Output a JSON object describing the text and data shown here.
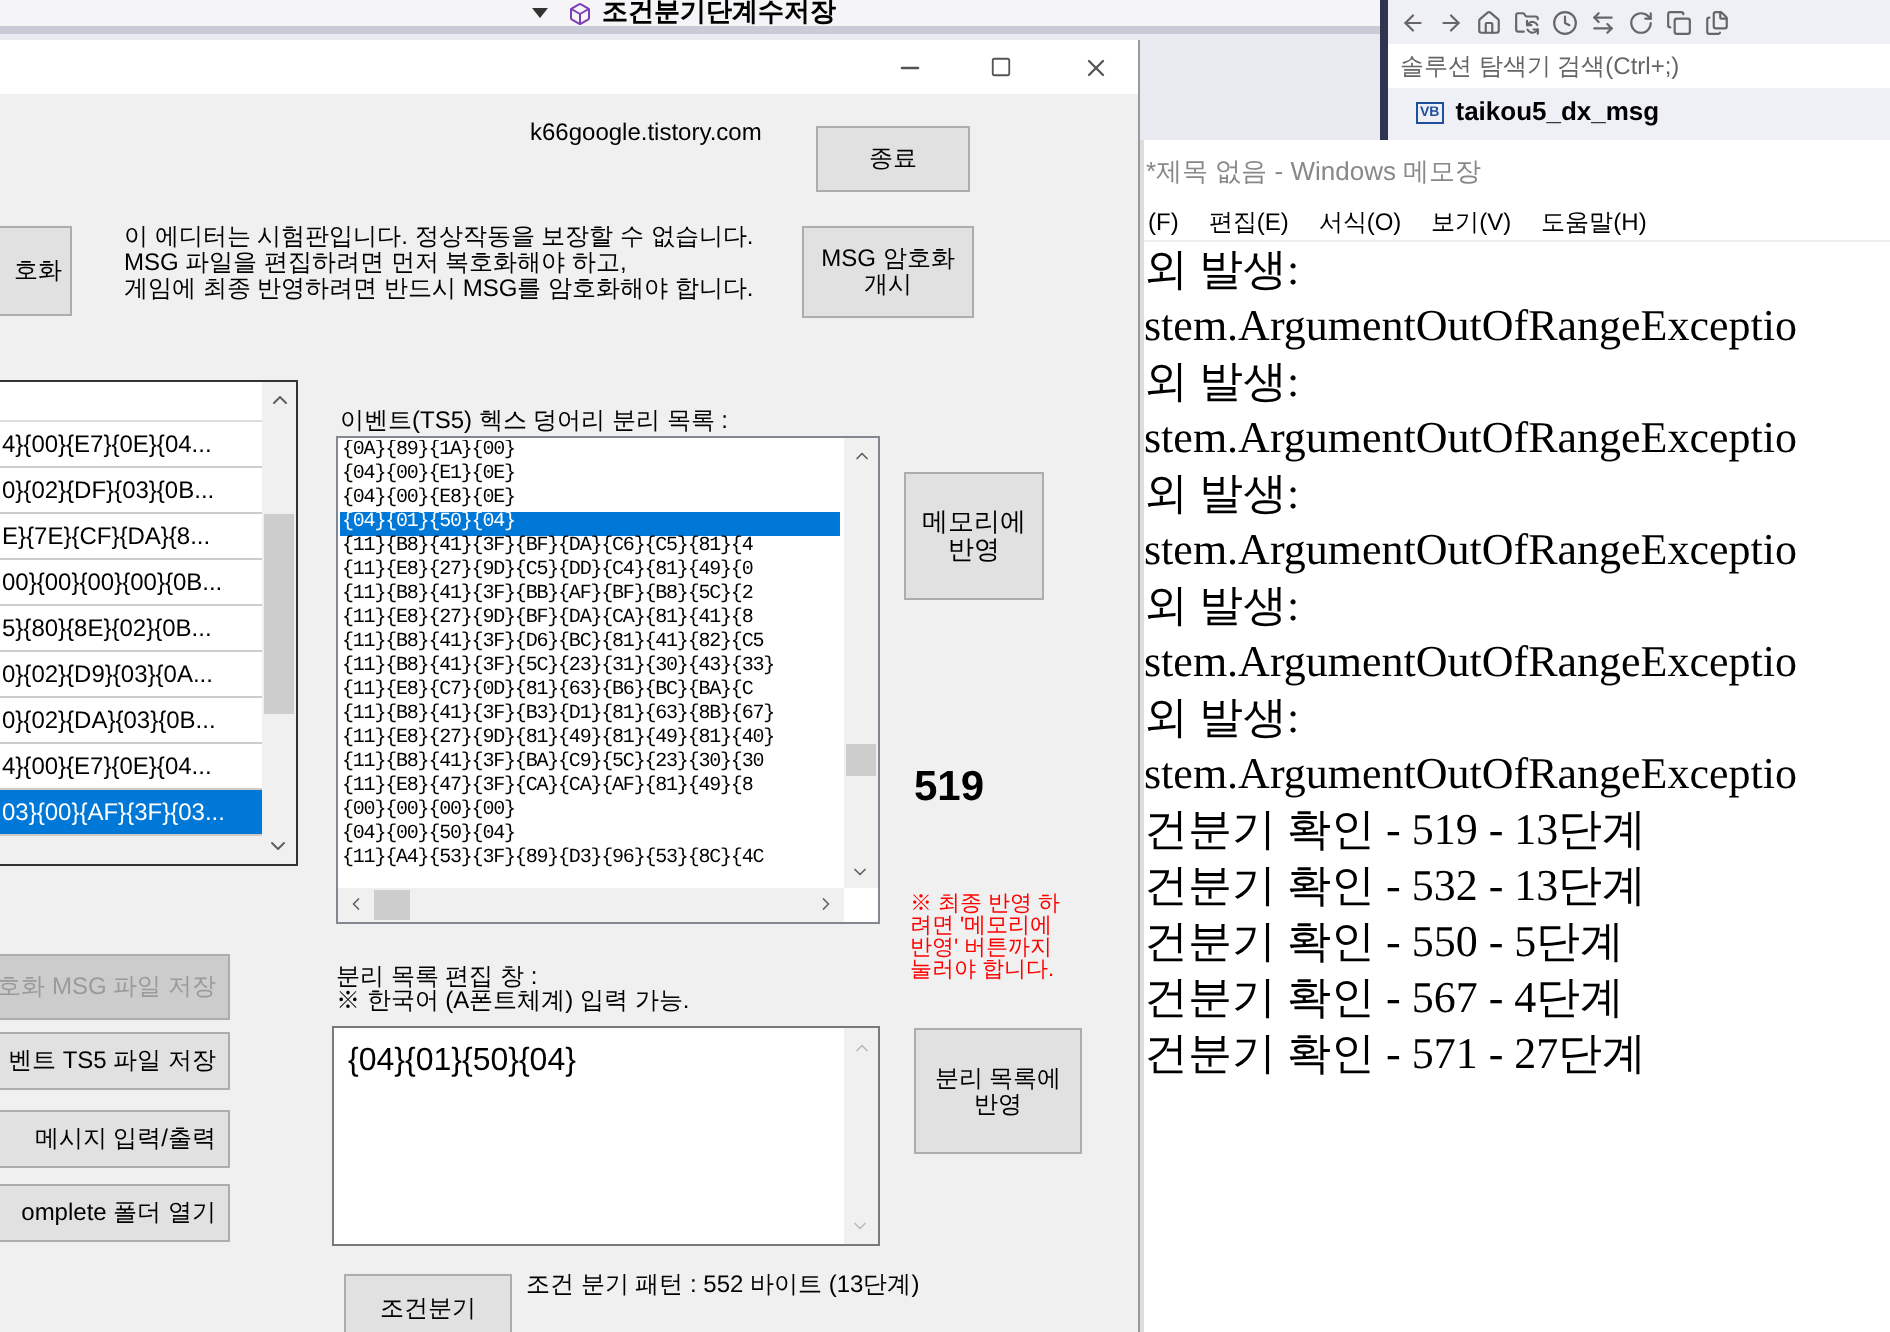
{
  "ide": {
    "tab_title": "조건분기단계수저장",
    "solution_search": {
      "placeholder": "솔루션 탐색기 검색(Ctrl+;)"
    },
    "solution_item": {
      "badge": "VB",
      "label": "taikou5_dx_msg"
    }
  },
  "editor": {
    "site": "k66google.tistory.com",
    "top_buttons": [
      {
        "label": "호화",
        "disabled": false
      },
      {
        "label": "종료",
        "disabled": false
      },
      {
        "label": "MSG 암호화\n개시",
        "disabled": false
      }
    ],
    "notice_lines": [
      "이 에디터는 시험판입니다. 정상작동을 보장할 수 없습니다.",
      "MSG 파일을 편집하려면 먼저 복호화해야 하고,",
      "게임에 최종 반영하려면 반드시 MSG를 암호화해야 합니다."
    ],
    "message_list": [
      {
        "text": "4}{00}{E7}{0E}{04...",
        "selected": false
      },
      {
        "text": "0}{02}{DF}{03}{0B...",
        "selected": false
      },
      {
        "text": "E}{7E}{CF}{DA}{8...",
        "selected": false
      },
      {
        "text": "00}{00}{00}{00}{0B...",
        "selected": false
      },
      {
        "text": "5}{80}{8E}{02}{0B...",
        "selected": false
      },
      {
        "text": "0}{02}{D9}{03}{0A...",
        "selected": false
      },
      {
        "text": "0}{02}{DA}{03}{0B...",
        "selected": false
      },
      {
        "text": "4}{00}{E7}{0E}{04...",
        "selected": false
      },
      {
        "text": "03}{00}{AF}{3F}{03...",
        "selected": true
      }
    ],
    "hex_list_label": "이벤트(TS5) 헥스 덩어리 분리 목록 :",
    "hex_list": [
      {
        "text": "{0A}{89}{1A}{00}",
        "selected": false
      },
      {
        "text": "{04}{00}{E1}{0E}",
        "selected": false
      },
      {
        "text": "{04}{00}{E8}{0E}",
        "selected": false
      },
      {
        "text": "{04}{01}{50}{04}",
        "selected": true
      },
      {
        "text": "{11}{B8}{41}{3F}{BF}{DA}{C6}{C5}{81}{4",
        "selected": false
      },
      {
        "text": "{11}{E8}{27}{9D}{C5}{DD}{C4}{81}{49}{0",
        "selected": false
      },
      {
        "text": "{11}{B8}{41}{3F}{BB}{AF}{BF}{B8}{5C}{2",
        "selected": false
      },
      {
        "text": "{11}{E8}{27}{9D}{BF}{DA}{CA}{81}{41}{8",
        "selected": false
      },
      {
        "text": "{11}{B8}{41}{3F}{D6}{BC}{81}{41}{82}{C5",
        "selected": false
      },
      {
        "text": "{11}{B8}{41}{3F}{5C}{23}{31}{30}{43}{33}",
        "selected": false
      },
      {
        "text": "{11}{E8}{C7}{0D}{81}{63}{B6}{BC}{BA}{C",
        "selected": false
      },
      {
        "text": "{11}{B8}{41}{3F}{B3}{D1}{81}{63}{8B}{67}",
        "selected": false
      },
      {
        "text": "{11}{E8}{27}{9D}{81}{49}{81}{49}{81}{40}",
        "selected": false
      },
      {
        "text": "{11}{B8}{41}{3F}{BA}{C9}{5C}{23}{30}{30",
        "selected": false
      },
      {
        "text": "{11}{E8}{47}{3F}{CA}{CA}{AF}{81}{49}{8",
        "selected": false
      },
      {
        "text": "{00}{00}{00}{00}",
        "selected": false
      },
      {
        "text": "{04}{00}{50}{04}",
        "selected": false
      },
      {
        "text": "{11}{A4}{53}{3F}{89}{D3}{96}{53}{8C}{4C",
        "selected": false
      }
    ],
    "memory_button": {
      "label": "메모리에\n반영"
    },
    "selected_index": "519",
    "warning_lines": [
      "※ 최종 반영 하",
      "려면 '메모리에",
      "반영' 버튼까지",
      "눌러야 합니다."
    ],
    "side_buttons": [
      {
        "label": "호화 MSG 파일 저장",
        "disabled": true
      },
      {
        "label": "벤트 TS5 파일 저장",
        "disabled": false
      },
      {
        "label": "메시지 입력/출력",
        "disabled": false
      },
      {
        "label": "omplete 폴더 열기",
        "disabled": false
      }
    ],
    "edit_label_lines": [
      "분리 목록 편집 창 :",
      "※ 한국어 (A폰트체계) 입력 가능."
    ],
    "edit_box": {
      "value": "{04}{01}{50}{04}"
    },
    "apply_button": {
      "label": "분리 목록에\n반영"
    },
    "step_button": {
      "label": "조건분기"
    },
    "pattern_info": "조건 분기 패턴 : 552 바이트 (13단계)"
  },
  "notepad": {
    "title": "*제목 없음 - Windows 메모장",
    "menu": [
      "(F)",
      "편집(E)",
      "서식(O)",
      "보기(V)",
      "도움말(H)"
    ],
    "lines": [
      "외 발생:",
      "stem.ArgumentOutOfRangeExceptio",
      "외 발생:",
      "stem.ArgumentOutOfRangeExceptio",
      "외 발생:",
      "stem.ArgumentOutOfRangeExceptio",
      "외 발생:",
      "stem.ArgumentOutOfRangeExceptio",
      "외 발생:",
      "stem.ArgumentOutOfRangeExceptio",
      "건분기 확인 - 519 - 13단계",
      "건분기 확인 - 532 - 13단계",
      "건분기 확인 - 550 - 5단계",
      "건분기 확인 - 567 - 4단계",
      "건분기 확인 - 571 - 27단계"
    ]
  }
}
